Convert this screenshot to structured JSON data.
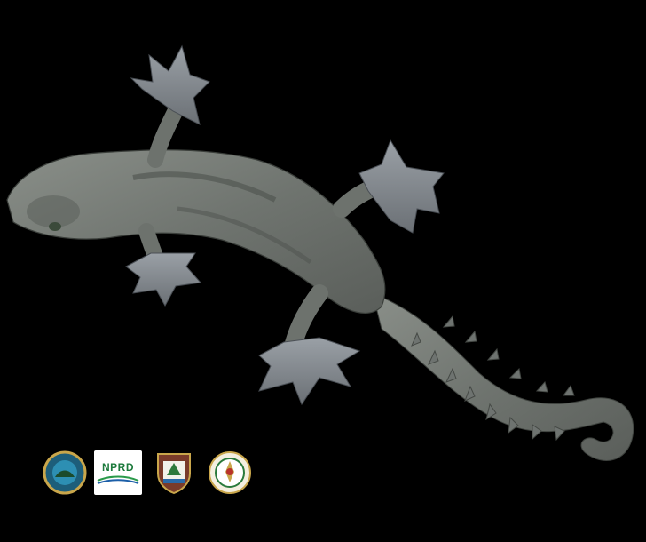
{
  "photo": {
    "subject": "gecko",
    "background_color": "#000000",
    "body_color": "#7a7f7a",
    "shadow_color": "#4a4e4b"
  },
  "logos": [
    {
      "icon": "round-emblem-icon",
      "text": ""
    },
    {
      "icon": "nprd-park-logo",
      "text": "NPRD"
    },
    {
      "icon": "shield-crest-icon",
      "text": ""
    },
    {
      "icon": "royal-seal-icon",
      "text": ""
    }
  ]
}
